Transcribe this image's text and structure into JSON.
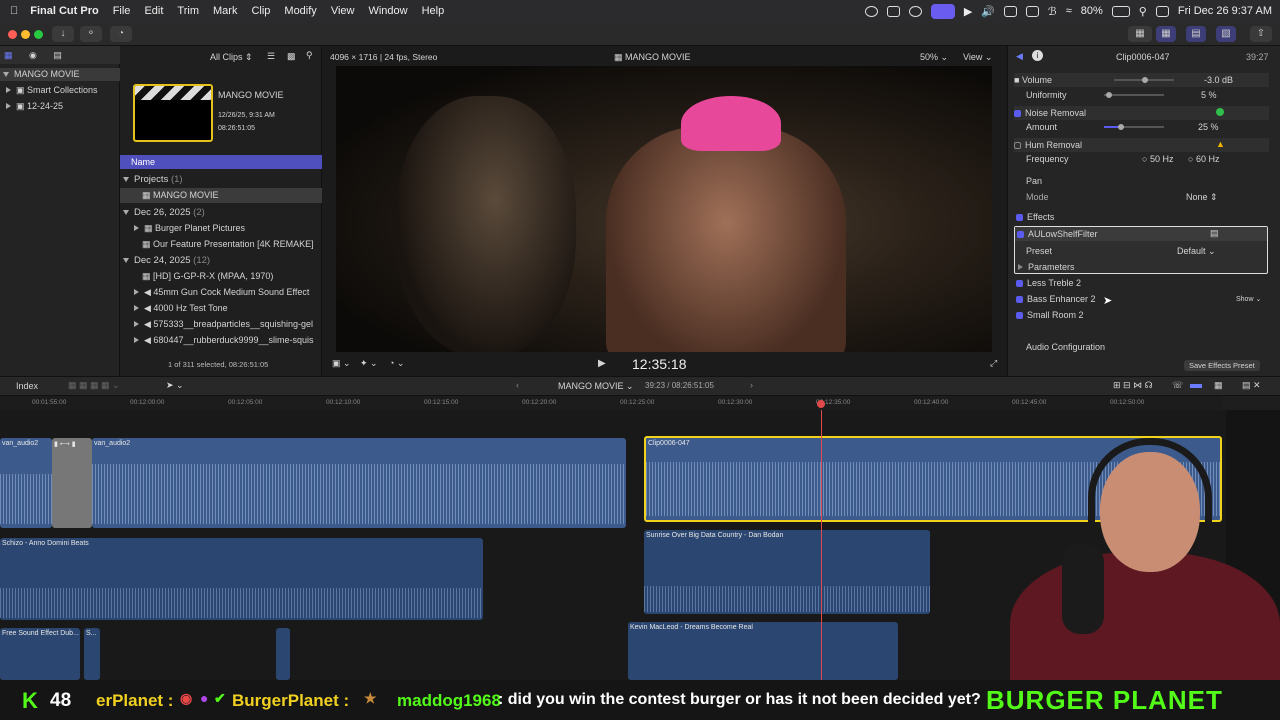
{
  "menubar": {
    "app": "Final Cut Pro",
    "items": [
      "File",
      "Edit",
      "Trim",
      "Mark",
      "Clip",
      "Modify",
      "View",
      "Window",
      "Help"
    ],
    "battery": "80%",
    "datetime": "Fri Dec 26  9:37 AM"
  },
  "toolbar": {
    "library_icon": "film-library-icon"
  },
  "library": {
    "items": [
      {
        "label": "MANGO MOVIE"
      },
      {
        "label": "Smart Collections"
      },
      {
        "label": "12-24-25"
      }
    ]
  },
  "browser": {
    "filter": "All Clips",
    "project_title": "MANGO MOVIE",
    "project_date": "12/26/25, 9:31 AM",
    "project_duration": "08:26:51:05",
    "column_header": "Name",
    "groups": [
      {
        "label": "Projects",
        "count": "(1)",
        "items": [
          "MANGO MOVIE"
        ]
      },
      {
        "label": "Dec 26, 2025",
        "count": "(2)",
        "items": [
          "Burger Planet Pictures",
          "Our Feature Presentation [4K REMAKE]"
        ]
      },
      {
        "label": "Dec 24, 2025",
        "count": "(12)",
        "items": [
          "[HD] G-GP-R-X (MPAA, 1970)",
          "45mm Gun Cock Medium Sound Effect",
          "4000 Hz Test Tone",
          "575333__breadparticles__squishing-gel",
          "680447__rubberduck9999__slime-squis"
        ]
      }
    ],
    "selection_status": "1 of 311 selected, 08:26:51:05"
  },
  "viewer": {
    "format": "4096 × 1716 | 24 fps, Stereo",
    "title": "MANGO MOVIE",
    "zoom": "50%",
    "view": "View",
    "timecode": "12:35:18"
  },
  "inspector": {
    "clip_name": "Clip0006-047",
    "duration": "39:27",
    "volume_label": "Volume",
    "volume_value": "-3.0",
    "volume_unit": "dB",
    "uniformity_label": "Uniformity",
    "uniformity_value": "5",
    "uniformity_unit": "%",
    "noise_removal": "Noise Removal",
    "amount_label": "Amount",
    "amount_value": "25",
    "amount_unit": "%",
    "hum_removal": "Hum Removal",
    "frequency_label": "Frequency",
    "freq_50": "50 Hz",
    "freq_60": "60 Hz",
    "pan_label": "Pan",
    "mode_label": "Mode",
    "mode_value": "None",
    "effects_label": "Effects",
    "filter_name": "AULowShelfFilter",
    "preset_label": "Preset",
    "preset_value": "Default",
    "parameters_label": "Parameters",
    "effect_1": "Less Treble 2",
    "effect_2": "Bass Enhancer 2",
    "effect_2_action": "Show",
    "effect_3": "Small Room 2",
    "audio_config": "Audio Configuration",
    "save_preset": "Save Effects Preset"
  },
  "timeline": {
    "index_label": "Index",
    "project": "MANGO MOVIE",
    "position": "39:23 / 08:26:51:05",
    "ruler": [
      "00:01:55:00",
      "00:12:00:00",
      "00:12:05:00",
      "00:12:10:00",
      "00:12:15:00",
      "00:12:20:00",
      "00:12:25:00",
      "00:12:30:00",
      "00:12:35:00",
      "00:12:40:00",
      "00:12:45:00",
      "00:12:50:00"
    ],
    "clips": {
      "van_audio_a": "van_audio2",
      "van_audio_b": "van_audio2",
      "clip_sel": "Clip0006-047",
      "music_1": "Schizo - Anno Domini Beats",
      "music_2": "Sunrise Over Big Data Country - Dan Bodan",
      "music_3": "Kevin MacLeod - Dreams Become Real",
      "sfx": "Free Sound Effect Dub...",
      "sfx_b": "S..."
    }
  },
  "chat": {
    "kick_count": "48",
    "user_1": "erPlanet :",
    "user_2": "BurgerPlanet :",
    "user_3": "maddog1968",
    "message": ": did you win the contest burger or has it not been decided yet?",
    "banner": "BURGER PLANET"
  },
  "colors": {
    "accent": "#5b5bf0",
    "selection": "#f2d31b",
    "clip": "#3c5b8c",
    "kick": "#53fc18"
  }
}
